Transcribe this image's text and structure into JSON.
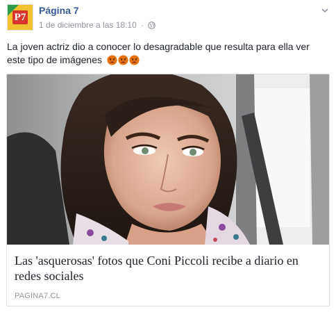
{
  "post": {
    "page_name": "Página 7",
    "avatar_text": "P7",
    "timestamp": "1 de diciembre a las 18:10",
    "separator": "·",
    "privacy_icon": "globe-icon",
    "menu_icon": "chevron-down-icon",
    "message": "La joven actriz dio a conocer lo desagradable que resulta para ella ver este tipo de imágenes",
    "reaction_emojis": [
      "angry-face-icon",
      "angry-face-icon",
      "angry-face-icon"
    ]
  },
  "link": {
    "image_icon": "selfie-photo",
    "title": "Las 'asquerosas' fotos que Coni Piccoli recibe a diario en redes sociales",
    "domain": "PAGINA7.CL"
  },
  "colors": {
    "link_blue": "#365899",
    "meta_gray": "#90949c",
    "text": "#1d2129",
    "border": "#dddfe2",
    "angry": "#e9710f"
  }
}
